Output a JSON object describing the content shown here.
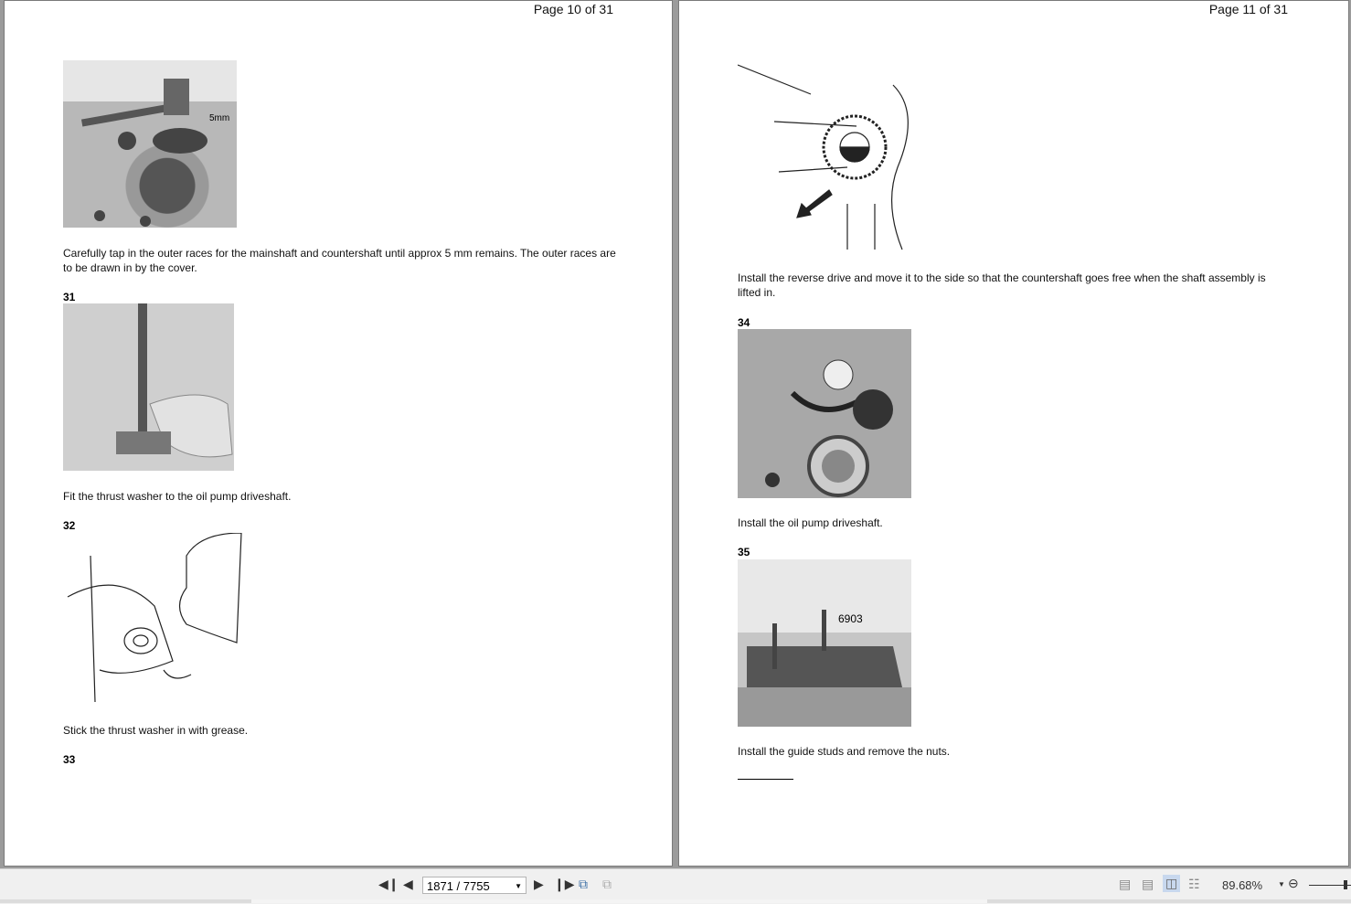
{
  "pages": [
    {
      "header": "Page 10 of 31",
      "intro_text": "Carefully tap in the outer races for the mainshaft and countershaft until approx 5 mm remains. The outer races are to be drawn in by the cover.",
      "image1_label": "5mm",
      "steps": [
        {
          "number": "31",
          "caption": "Fit the thrust washer to the oil pump driveshaft."
        },
        {
          "number": "32",
          "caption": "Stick the thrust washer in with grease."
        },
        {
          "number": "33"
        }
      ]
    },
    {
      "header": "Page 11 of 31",
      "intro_text": "Install the reverse drive and move it to the side so that the countershaft goes free when the shaft assembly is lifted in.",
      "steps": [
        {
          "number": "34",
          "caption": "Install the oil pump driveshaft."
        },
        {
          "number": "35",
          "caption": "Install the guide studs and remove the nuts.",
          "image_label": "6903"
        }
      ]
    }
  ],
  "toolbar": {
    "page_field": "1871 / 7755",
    "zoom": "89.68%"
  }
}
